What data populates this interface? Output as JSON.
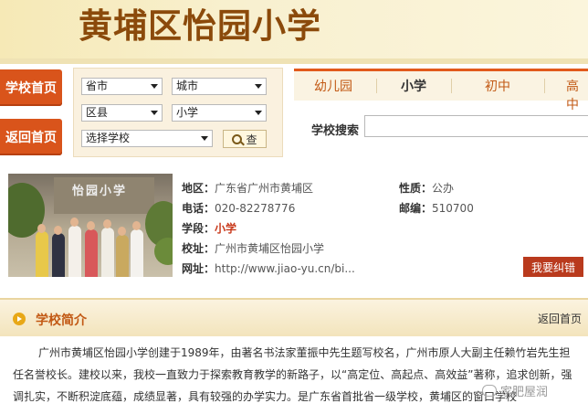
{
  "header": {
    "title": "黄埔区怡园小学"
  },
  "sidebar": {
    "school_home": "学校首页",
    "back_home": "返回首页"
  },
  "filters": {
    "city": "省市",
    "district": "城市",
    "county": "区县",
    "level": "小学",
    "school": "选择学校",
    "search_button": "查"
  },
  "tabs": [
    {
      "label": "幼儿园",
      "active": false
    },
    {
      "label": "小学",
      "active": true
    },
    {
      "label": "初中",
      "active": false
    },
    {
      "label": "高中",
      "active": false
    }
  ],
  "search": {
    "label": "学校搜索"
  },
  "photo": {
    "sign": "怡园小学"
  },
  "school_info": {
    "address_label": "地区：",
    "address": "广东省广州市黄埔区",
    "nature_label": "性质：",
    "nature": "公办",
    "phone_label": "电话：",
    "phone": "020-82278776",
    "zip_label": "邮编：",
    "zip": "510700",
    "stage_label": "学段：",
    "stage": "小学",
    "school_label": "校址：",
    "school_addr": "广州市黄埔区怡园小学",
    "url_label": "网址：",
    "url": "http://www.jiao-yu.cn/bi..."
  },
  "fix_button": "我要纠错",
  "section": {
    "title": "学校简介",
    "back": "返回首页"
  },
  "intro_text": "广州市黄埔区怡园小学创建于1989年，由著名书法家董振中先生题写校名，广州市原人大副主任赖竹岩先生担任名誉校长。建校以来，我校一直致力于探索教育教学的新路子，以“高定位、高起点、高效益”著称，追求创新，强调扎实，不断积淀底蕴，成绩显著，具有较强的办学实力。是广东省首批省一级学校，黄埔区的窗口学校",
  "watermark": "家肥屋润",
  "colors": {
    "accent": "#d9541b",
    "brand_text": "#8b4a0b",
    "link": "#c25914"
  }
}
